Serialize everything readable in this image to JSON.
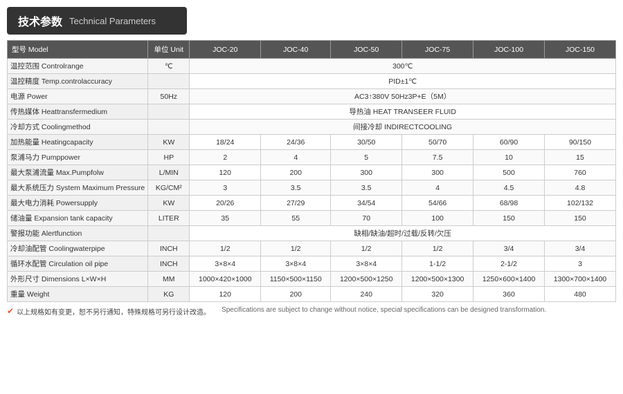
{
  "header": {
    "zh": "技术参数",
    "en": "Technical Parameters"
  },
  "table": {
    "columns": [
      {
        "label": "型号 Model"
      },
      {
        "label": "单位 Unit"
      },
      {
        "label": "JOC-20"
      },
      {
        "label": "JOC-40"
      },
      {
        "label": "JOC-50"
      },
      {
        "label": "JOC-75"
      },
      {
        "label": "JOC-100"
      },
      {
        "label": "JOC-150"
      }
    ],
    "rows": [
      {
        "label": "温控范围 Controlrange",
        "unit": "℃",
        "span": true,
        "spanValue": "300℃"
      },
      {
        "label": "温控精度 Temp.controlaccuracy",
        "unit": "",
        "span": true,
        "spanValue": "PID±1℃"
      },
      {
        "label": "电源 Power",
        "unit": "50Hz",
        "span": true,
        "spanValue": "AC3↑380V 50Hz3P+E（5M）"
      },
      {
        "label": "传热媒体 Heattransfermedium",
        "unit": "",
        "span": true,
        "spanValue": "导热油 HEAT TRANSEER FLUID"
      },
      {
        "label": "冷却方式 Coolingmethod",
        "unit": "",
        "span": true,
        "spanValue": "间接冷却 INDIRECTCOOLING"
      },
      {
        "label": "加热能量 Heatingcapacity",
        "unit": "KW",
        "span": false,
        "values": [
          "18/24",
          "24/36",
          "30/50",
          "50/70",
          "60/90",
          "90/150"
        ]
      },
      {
        "label": "泵浦马力 Pumppower",
        "unit": "HP",
        "span": false,
        "values": [
          "2",
          "4",
          "5",
          "7.5",
          "10",
          "15"
        ]
      },
      {
        "label": "最大泵浦流量 Max.Pumpfolw",
        "unit": "L/MIN",
        "span": false,
        "values": [
          "120",
          "200",
          "300",
          "300",
          "500",
          "760"
        ]
      },
      {
        "label": "最大系统压力 System Maximum Pressure",
        "unit": "KG/CM²",
        "span": false,
        "values": [
          "3",
          "3.5",
          "3.5",
          "4",
          "4.5",
          "4.8"
        ]
      },
      {
        "label": "最大电力消耗 Powersupply",
        "unit": "KW",
        "span": false,
        "values": [
          "20/26",
          "27/29",
          "34/54",
          "54/66",
          "68/98",
          "102/132"
        ]
      },
      {
        "label": "储油量 Expansion tank capacity",
        "unit": "LITER",
        "span": false,
        "values": [
          "35",
          "55",
          "70",
          "100",
          "150",
          "150"
        ]
      },
      {
        "label": "警报功能 Alertfunction",
        "unit": "",
        "span": true,
        "spanValue": "缺相/缺油/超时/过载/反转/欠压"
      },
      {
        "label": "冷却油配管 Coolingwaterpipe",
        "unit": "INCH",
        "span": false,
        "values": [
          "1/2",
          "1/2",
          "1/2",
          "1/2",
          "3/4",
          "3/4"
        ]
      },
      {
        "label": "循环水配管 Circulation oil pipe",
        "unit": "INCH",
        "span": false,
        "values": [
          "3×8×4",
          "3×8×4",
          "3×8×4",
          "1-1/2",
          "2-1/2",
          "3"
        ]
      },
      {
        "label": "外形尺寸 Dimensions L×W×H",
        "unit": "MM",
        "span": false,
        "values": [
          "1000×420×1000",
          "1150×500×1150",
          "1200×500×1250",
          "1200×500×1300",
          "1250×600×1400",
          "1300×700×1400"
        ]
      },
      {
        "label": "重量 Weight",
        "unit": "KG",
        "span": false,
        "values": [
          "120",
          "200",
          "240",
          "320",
          "360",
          "480"
        ]
      }
    ]
  },
  "footer": {
    "zh": "以上规格如有变更，恕不另行通知，特殊规格可另行设计改造。",
    "en": "Specifications are subject to change without notice, special specifications can be designed transformation.",
    "icon": "✔"
  }
}
